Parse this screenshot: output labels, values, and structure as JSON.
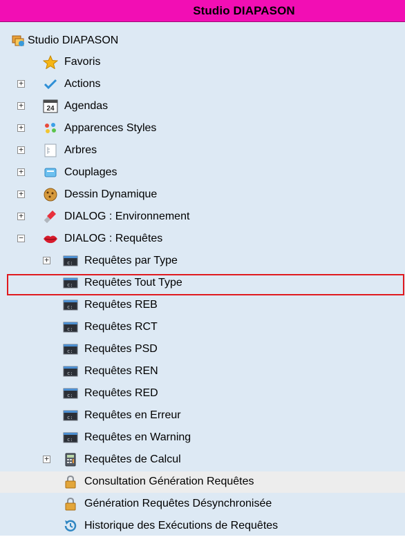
{
  "window": {
    "title": "Studio DIAPASON"
  },
  "colors": {
    "title_bar": "#f20eb4",
    "panel_bg": "#dde9f4",
    "selection_border": "#e0191e"
  },
  "tree": {
    "root": {
      "label": "Studio DIAPASON",
      "icon": "studio-diapason-icon"
    },
    "favoris": {
      "label": "Favoris",
      "icon": "star-icon"
    },
    "actions": {
      "label": "Actions",
      "icon": "checkmark-icon"
    },
    "agendas": {
      "label": "Agendas",
      "icon": "calendar-icon",
      "icon_text": "24"
    },
    "apparences": {
      "label": "Apparences Styles",
      "icon": "palette-icon"
    },
    "arbres": {
      "label": "Arbres",
      "icon": "tree-list-icon"
    },
    "couplages": {
      "label": "Couplages",
      "icon": "window-icon"
    },
    "dessin": {
      "label": "Dessin Dynamique",
      "icon": "cookie-icon"
    },
    "dialog_env": {
      "label": "DIALOG : Environnement",
      "icon": "lipstick-icon"
    },
    "dialog_req": {
      "label": "DIALOG : Requêtes",
      "icon": "lips-icon",
      "expanded": true
    },
    "requetes": [
      {
        "label": "Requêtes par Type",
        "icon": "terminal-icon",
        "has_children": true
      },
      {
        "label": "Requêtes Tout Type",
        "icon": "terminal-icon",
        "selected": true
      },
      {
        "label": "Requêtes REB",
        "icon": "terminal-icon"
      },
      {
        "label": "Requêtes RCT",
        "icon": "terminal-icon"
      },
      {
        "label": "Requêtes PSD",
        "icon": "terminal-icon"
      },
      {
        "label": "Requêtes REN",
        "icon": "terminal-icon"
      },
      {
        "label": "Requêtes RED",
        "icon": "terminal-icon"
      },
      {
        "label": "Requêtes en Erreur",
        "icon": "terminal-icon"
      },
      {
        "label": "Requêtes en Warning",
        "icon": "terminal-icon"
      },
      {
        "label": "Requêtes de Calcul",
        "icon": "calculator-icon",
        "has_children": true
      },
      {
        "label": "Consultation Génération Requêtes",
        "icon": "padlock-icon",
        "hovered": true
      },
      {
        "label": "Génération Requêtes Désynchronisée",
        "icon": "padlock-icon"
      },
      {
        "label": "Historique des Exécutions de Requêtes",
        "icon": "history-icon"
      }
    ]
  }
}
